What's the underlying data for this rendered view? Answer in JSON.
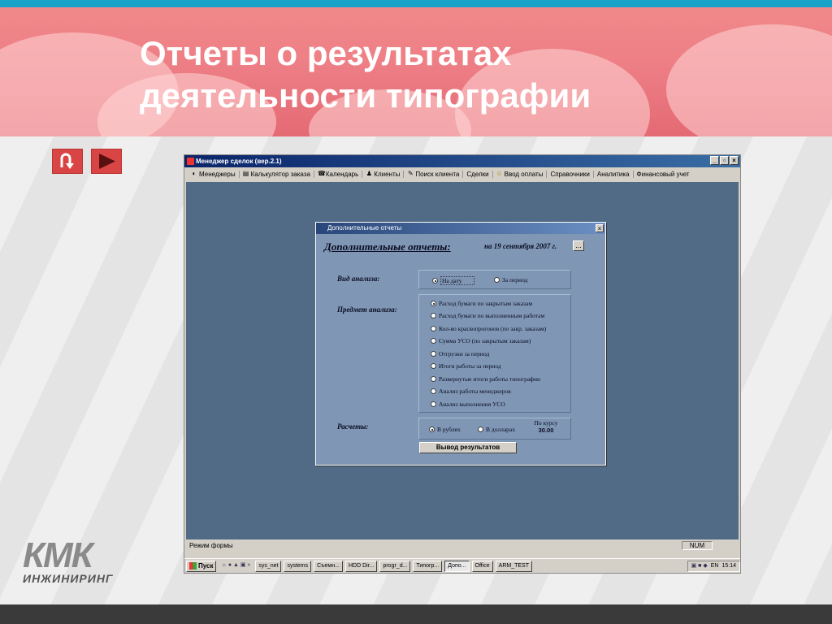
{
  "slide": {
    "title_line1": "Отчеты о результатах",
    "title_line2": "деятельности типографии",
    "logo_main": "КМК",
    "logo_sub": "ИНЖИНИРИНГ"
  },
  "nav": {
    "back_icon": "u-turn-arrow-icon",
    "next_icon": "play-triangle-icon"
  },
  "app": {
    "title": "Менеджер сделок (вер.2.1)",
    "window_buttons": [
      "_",
      "▫",
      "×"
    ],
    "menu": [
      {
        "label": "Менеджеры",
        "icon": "◐"
      },
      {
        "label": "Калькулятор заказа",
        "icon": "▤"
      },
      {
        "label": "Календарь",
        "icon": "☎"
      },
      {
        "label": "Клиенты",
        "icon": "♟"
      },
      {
        "label": "Поиск клиента",
        "icon": "✎"
      },
      {
        "label": "Сделки",
        "icon": ""
      },
      {
        "label": "Ввод оплаты",
        "icon": "☺"
      },
      {
        "label": "Справочники",
        "icon": ""
      },
      {
        "label": "Аналитика",
        "icon": ""
      },
      {
        "label": "Финансовый учет",
        "icon": ""
      }
    ],
    "status_left": "Режим формы",
    "status_num": "NUM"
  },
  "taskbar": {
    "start": "Пуск",
    "items": [
      "sys_net",
      "systems",
      "Съемн...",
      "HDD Dir...",
      "progr_d...",
      "Типогр...",
      "Допо...",
      "Office",
      "ARM_TEST"
    ],
    "active_index": 6,
    "lang": "EN",
    "time": "15:14"
  },
  "dialog": {
    "title": "Дополнительные отчеты",
    "close": "×",
    "heading": "Дополнительные отчеты:",
    "date_text": "на 19 сентября 2007 г.",
    "date_button": "...",
    "analysis_type_label": "Вид анализа:",
    "analysis_types": [
      "На дату",
      "За период"
    ],
    "analysis_type_selected": 0,
    "subject_label": "Предмет анализа:",
    "subjects": [
      "Расход бумаги по закрытым заказам",
      "Расход бумаги по выполненным работам",
      "Кол-во краскопрогонов (по закр. заказам)",
      "Сумма УСО (по закрытым заказам)",
      "Отгрузки за период",
      "Итоги работы за период",
      "Развернутые итоги работы типографии",
      "Анализ работы менеджеров",
      "Анализ выполнения  УСО"
    ],
    "subject_selected": 0,
    "calc_label": "Расчеты:",
    "currencies": [
      "В рублях",
      "В долларах"
    ],
    "currency_selected": 0,
    "rate_label": "По курсу",
    "rate_value": "30.00",
    "run_button": "Вывод результатов"
  }
}
